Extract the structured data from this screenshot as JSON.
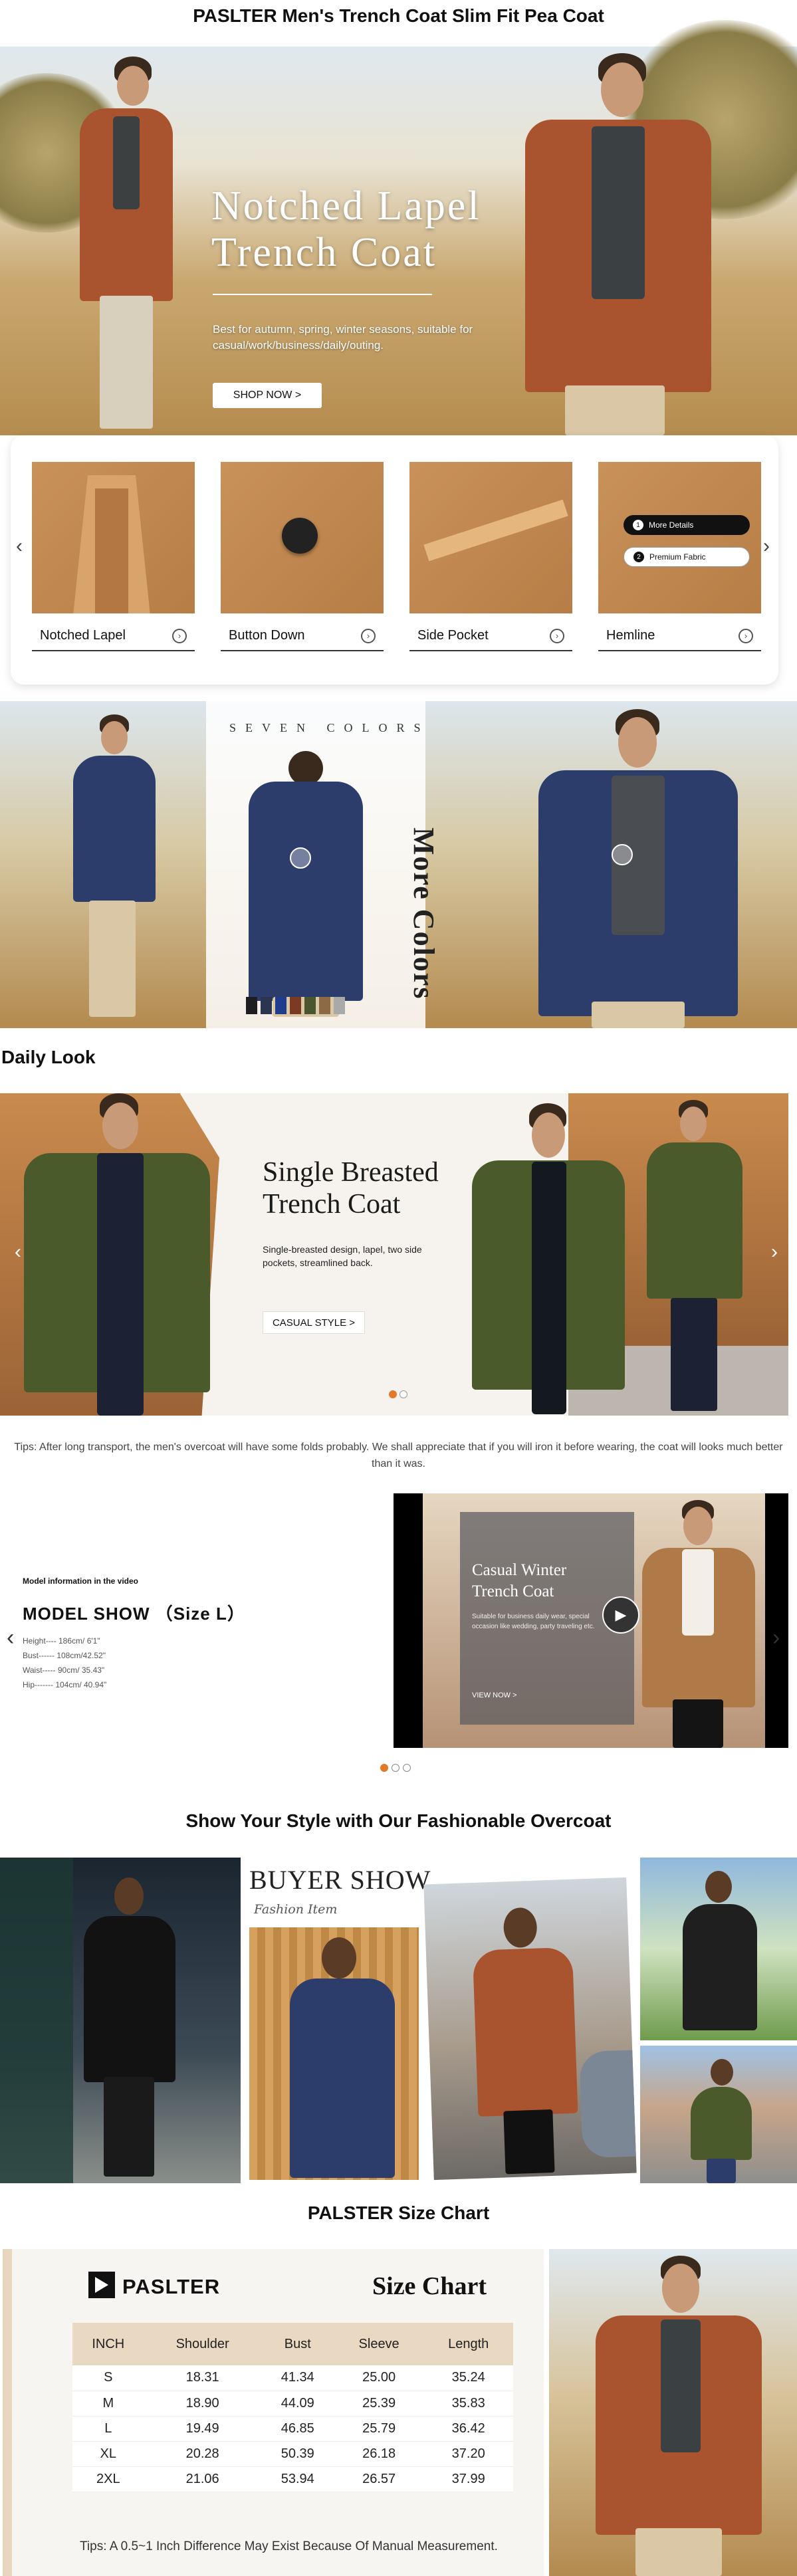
{
  "page_title": "PASLTER Men's Trench Coat Slim Fit Pea Coat",
  "hero": {
    "title_line1": "Notched Lapel",
    "title_line2": "Trench Coat",
    "subtitle": "Best for autumn, spring, winter seasons, suitable for casual/work/business/daily/outing.",
    "button": "SHOP NOW >"
  },
  "details": {
    "items": [
      {
        "label": "Notched Lapel"
      },
      {
        "label": "Button Down"
      },
      {
        "label": "Side Pocket"
      },
      {
        "label": "Hemline"
      }
    ],
    "pills": [
      "More Details",
      "Premium Fabric"
    ],
    "pill_numbers": [
      "1",
      "2"
    ],
    "prev_icon": "‹",
    "next_icon": "›",
    "item_arrow": "›"
  },
  "seven_colors": {
    "title": "SEVEN COLORS",
    "vertical_text": "More Colors",
    "swatches": [
      "#1e1e22",
      "#2b3550",
      "#1f3d8c",
      "#7a3b22",
      "#4b5530",
      "#8d6a45",
      "#a9a9a9"
    ]
  },
  "daily_look": {
    "heading": "Daily Look",
    "title_line1": "Single Breasted",
    "title_line2": "Trench Coat",
    "subtitle": "Single-breasted design, lapel, two side pockets, streamlined back.",
    "button": "CASUAL STYLE >",
    "prev_icon": "‹",
    "next_icon": "›"
  },
  "tips_top": "Tips: After long transport, the men's overcoat will have some folds probably. We shall appreciate that if you will iron it before wearing, the coat will looks much better than it was.",
  "model_show": {
    "small_label": "Model information in the video",
    "title": "MODEL SHOW （Size L）",
    "measurements": [
      "Height---- 186cm/ 6'1\"",
      "Bust------ 108cm/42.52\"",
      "Waist----- 90cm/ 35.43\"",
      "Hip------- 104cm/ 40.94\""
    ],
    "video_title_line1": "Casual Winter",
    "video_title_line2": "Trench Coat",
    "video_sub": "Suitable for business daily wear, special occasion like wedding, party traveling etc.",
    "video_btn": "VIEW NOW >",
    "play_icon": "▶",
    "prev_icon": "‹",
    "next_icon": "›"
  },
  "buyer_show": {
    "section_title": "Show Your Style with Our Fashionable Overcoat",
    "heading": "BUYER SHOW",
    "script": "Fashion Item"
  },
  "size_chart": {
    "section_title": "PALSTER Size Chart",
    "brand": "PASLTER",
    "title": "Size Chart",
    "headers": [
      "INCH",
      "Shoulder",
      "Bust",
      "Sleeve",
      "Length"
    ],
    "rows": [
      [
        "S",
        "18.31",
        "41.34",
        "25.00",
        "35.24"
      ],
      [
        "M",
        "18.90",
        "44.09",
        "25.39",
        "35.83"
      ],
      [
        "L",
        "19.49",
        "46.85",
        "25.79",
        "36.42"
      ],
      [
        "XL",
        "20.28",
        "50.39",
        "26.18",
        "37.20"
      ],
      [
        "2XL",
        "21.06",
        "53.94",
        "26.57",
        "37.99"
      ]
    ],
    "tips": "Tips: A 0.5~1 Inch Difference May Exist Because Of Manual Measurement."
  },
  "colors": {
    "rust": "#a9542f",
    "camel": "#c9925a",
    "navy": "#2c3d6b",
    "olive": "#4b5a2a",
    "accent_orange": "#e27a2c"
  }
}
